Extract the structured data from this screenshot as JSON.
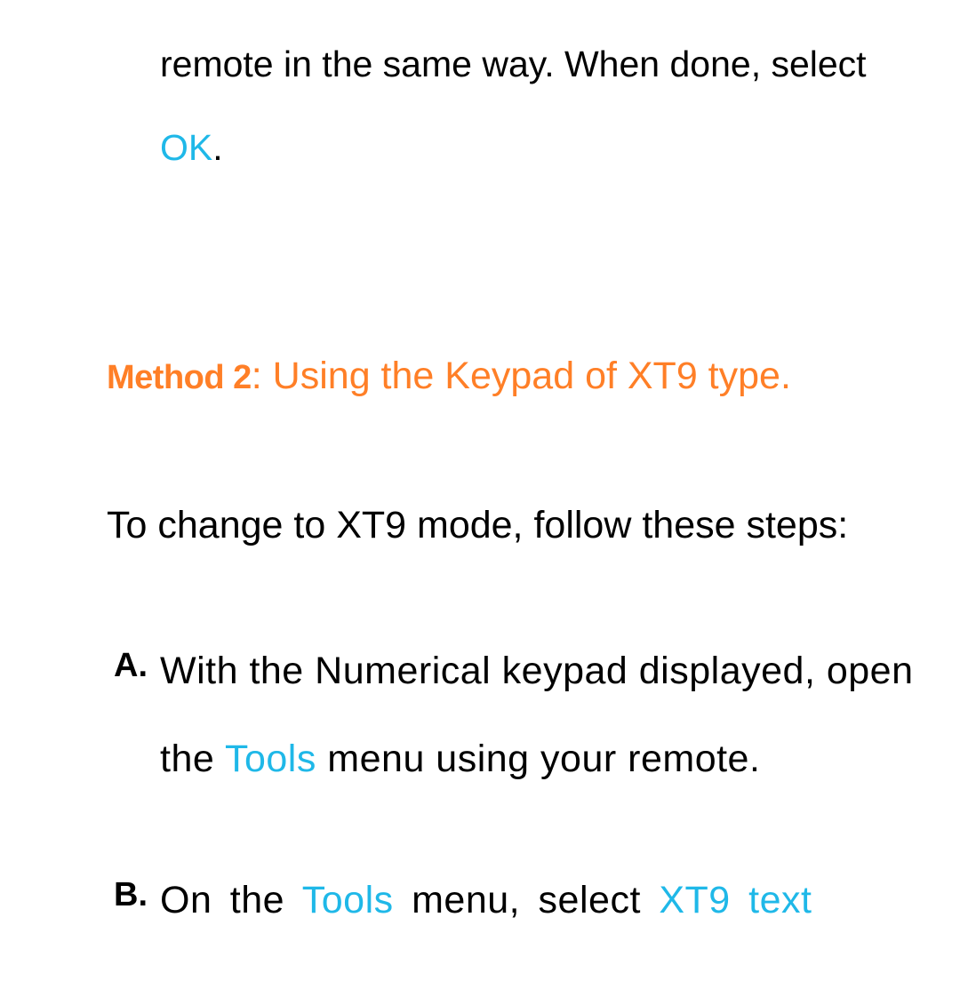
{
  "continuation": {
    "text_before": "remote in the same way. When done, select ",
    "ok_text": "OK",
    "text_after": "."
  },
  "method": {
    "label": "Method 2",
    "title": ": Using the Keypad of XT9 type."
  },
  "intro": "To change to XT9 mode, follow these steps:",
  "steps": {
    "a": {
      "letter": "A.",
      "text_before": "With the Numerical keypad displayed, open the ",
      "tools": "Tools",
      "text_after": " menu using your remote."
    },
    "b": {
      "letter": "B.",
      "text_before": "On the ",
      "tools": "Tools",
      "text_mid": " menu, select ",
      "xt9": "XT9 text"
    }
  }
}
